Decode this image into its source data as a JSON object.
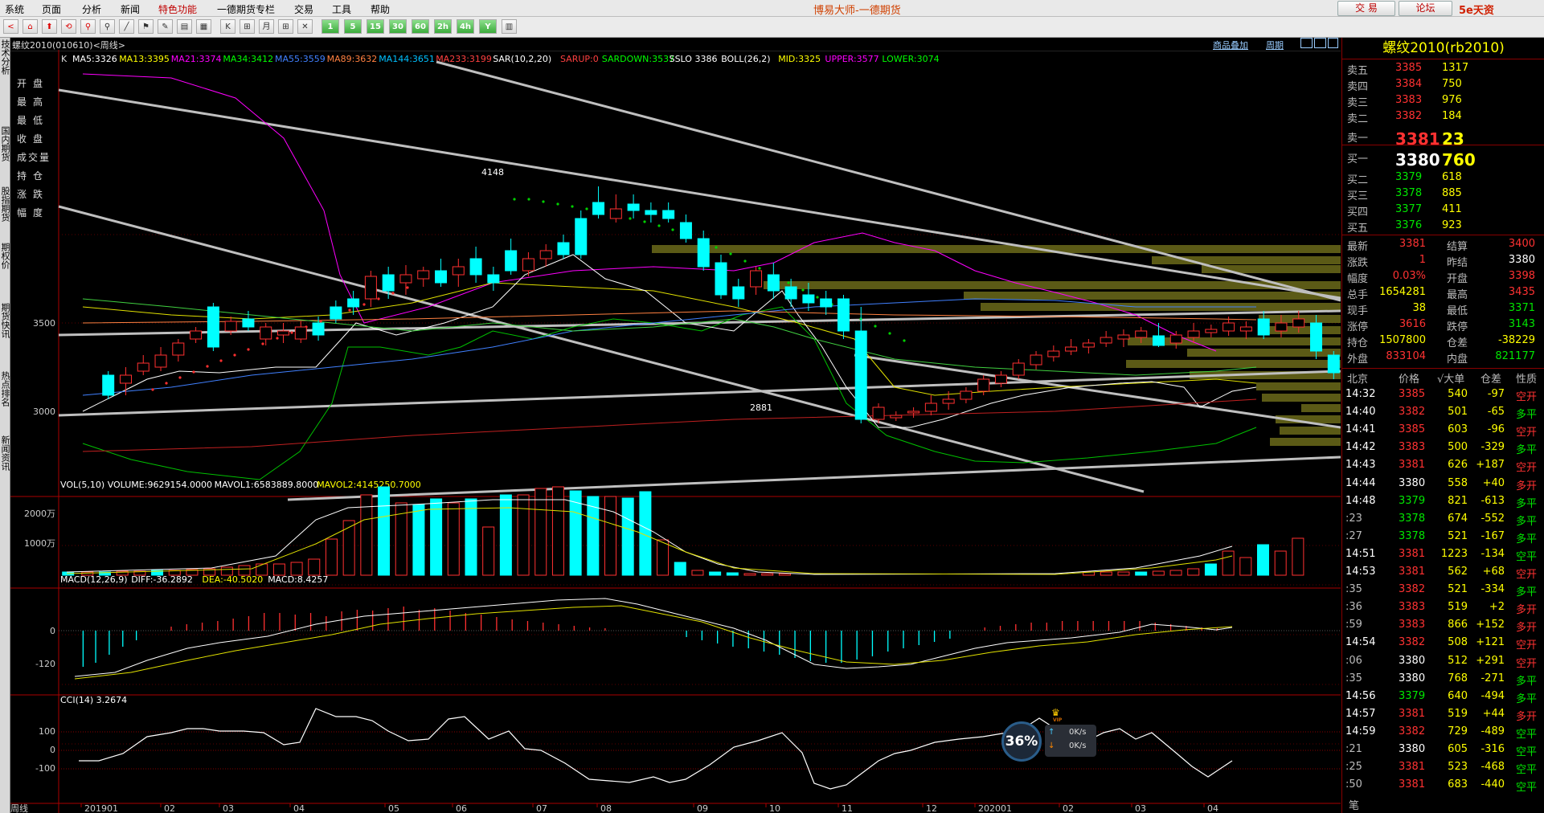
{
  "menu": [
    "系统",
    "页面",
    "分析",
    "新闻",
    "特色功能",
    "一德期货专栏",
    "交易",
    "工具",
    "帮助"
  ],
  "app_title": "博易大师-一德期货",
  "top_buttons": {
    "trade": "交 易",
    "forum": "论坛"
  },
  "logo": "5e天资 setz.com",
  "toolbar_items": [
    "<",
    "⌂",
    "⬆",
    "⟲",
    "⚲",
    "⚲",
    "╱",
    "⚑",
    "✎",
    "▤",
    "▦",
    "K",
    "⊞",
    "月",
    "⊞",
    "✕",
    "1",
    "5",
    "15",
    "30",
    "60",
    "2h",
    "4h",
    "Y",
    "▥"
  ],
  "left_tabs": [
    "技术分析",
    "国内期货",
    "股指期货",
    "期权价",
    "期货快讯",
    "热点排名",
    "新闻资讯"
  ],
  "left_labels": [
    "开盘",
    "最高",
    "最低",
    "收盘",
    "成交量",
    "持仓",
    "涨跌",
    "幅度"
  ],
  "chart_header": {
    "symbol": "螺纹2010(010610)<周线>",
    "add_product": "商品叠加",
    "period": "周期",
    "k": "K",
    "ma": [
      {
        "text": "MA5:3326",
        "color": "#ffffff"
      },
      {
        "text": "MA13:3395",
        "color": "#ffff00"
      },
      {
        "text": "MA21:3374",
        "color": "#ff00ff"
      },
      {
        "text": "MA34:3412",
        "color": "#00ff00"
      },
      {
        "text": "MA55:3559",
        "color": "#4080ff"
      },
      {
        "text": "MA89:3632",
        "color": "#ff8040"
      },
      {
        "text": "MA144:3651",
        "color": "#00c0ff"
      },
      {
        "text": "MA233:3199",
        "color": "#ff4040"
      },
      {
        "text": "SAR(10,2,20)",
        "color": "#ffffff"
      },
      {
        "text": "SARUP:0",
        "color": "#ff4040"
      },
      {
        "text": "SARDOWN:3537",
        "color": "#00ff00"
      },
      {
        "text": "SSLO 3386",
        "color": "#ffffff"
      },
      {
        "text": "BOLL(26,2)",
        "color": "#ffffff"
      },
      {
        "text": "MID:3325",
        "color": "#ffff00"
      },
      {
        "text": "UPPER:3577",
        "color": "#ff00ff"
      },
      {
        "text": "LOWER:3074",
        "color": "#00ff00"
      }
    ]
  },
  "price_axis": [
    "3500",
    "3000"
  ],
  "price_annotations": {
    "high": "4148",
    "low": "2881"
  },
  "volume_header": [
    {
      "text": "VOL(5,10) VOLUME:9629154.0000",
      "color": "#ffffff"
    },
    {
      "text": "MAVOL1:6583889.8000",
      "color": "#ffffff"
    },
    {
      "text": "MAVOL2:4145250.7000",
      "color": "#ffff00"
    }
  ],
  "volume_axis": [
    "2000万",
    "1000万"
  ],
  "macd_header": [
    {
      "text": "MACD(12,26,9)",
      "color": "#ffffff"
    },
    {
      "text": "DIFF:-36.2892",
      "color": "#ffffff"
    },
    {
      "text": "DEA:-40.5020",
      "color": "#ffff00"
    },
    {
      "text": "MACD:8.4257",
      "color": "#ffffff"
    }
  ],
  "macd_axis": [
    "0",
    "-120"
  ],
  "cci_header": [
    {
      "text": "CCI(14) 3.2674",
      "color": "#ffffff"
    }
  ],
  "cci_axis": [
    "100",
    "0",
    "-100"
  ],
  "time_axis": [
    "周线",
    "201901",
    "02",
    "03",
    "04",
    "05",
    "06",
    "07",
    "08",
    "09",
    "10",
    "11",
    "12",
    "202001",
    "02",
    "03",
    "04"
  ],
  "speed": {
    "percent": "36%",
    "up": "0K/s",
    "down": "0K/s",
    "badge": "VIP"
  },
  "quote": {
    "title": "螺纹2010(rb2010)",
    "asks": [
      {
        "label": "卖五",
        "price": "3385",
        "vol": "1317"
      },
      {
        "label": "卖四",
        "price": "3384",
        "vol": "750"
      },
      {
        "label": "卖三",
        "price": "3383",
        "vol": "976"
      },
      {
        "label": "卖二",
        "price": "3382",
        "vol": "184"
      },
      {
        "label": "卖一",
        "price": "3381",
        "vol": "23"
      }
    ],
    "bids": [
      {
        "label": "买一",
        "price": "3380",
        "vol": "760"
      },
      {
        "label": "买二",
        "price": "3379",
        "vol": "618"
      },
      {
        "label": "买三",
        "price": "3378",
        "vol": "885"
      },
      {
        "label": "买四",
        "price": "3377",
        "vol": "411"
      },
      {
        "label": "买五",
        "price": "3376",
        "vol": "923"
      }
    ],
    "stats": [
      {
        "l1": "最新",
        "v1": "3381",
        "c1": "red",
        "l2": "结算",
        "v2": "3400",
        "c2": "red"
      },
      {
        "l1": "涨跌",
        "v1": "1",
        "c1": "red",
        "l2": "昨结",
        "v2": "3380",
        "c2": "white"
      },
      {
        "l1": "幅度",
        "v1": "0.03%",
        "c1": "red",
        "l2": "开盘",
        "v2": "3398",
        "c2": "red"
      },
      {
        "l1": "总手",
        "v1": "1654281",
        "c1": "yellow",
        "l2": "最高",
        "v2": "3435",
        "c2": "red"
      },
      {
        "l1": "现手",
        "v1": "38",
        "c1": "yellow",
        "l2": "最低",
        "v2": "3371",
        "c2": "green"
      },
      {
        "l1": "涨停",
        "v1": "3616",
        "c1": "red",
        "l2": "跌停",
        "v2": "3143",
        "c2": "green"
      },
      {
        "l1": "持仓",
        "v1": "1507800",
        "c1": "yellow",
        "l2": "仓差",
        "v2": "-38229",
        "c2": "yellow"
      },
      {
        "l1": "外盘",
        "v1": "833104",
        "c1": "red",
        "l2": "内盘",
        "v2": "821177",
        "c2": "green"
      }
    ],
    "ticks_header": {
      "time": "北京",
      "price": "价格",
      "vol": "√大单",
      "diff": "仓差",
      "nature": "性质"
    },
    "ticks": [
      {
        "t": "14:32",
        "p": "3385",
        "pc": "red",
        "v": "540",
        "d": "-97",
        "n": "空开",
        "nc": "red"
      },
      {
        "t": "14:40",
        "p": "3382",
        "pc": "red",
        "v": "501",
        "d": "-65",
        "n": "多平",
        "nc": "green"
      },
      {
        "t": "14:41",
        "p": "3385",
        "pc": "red",
        "v": "603",
        "d": "-96",
        "n": "空开",
        "nc": "red"
      },
      {
        "t": "14:42",
        "p": "3383",
        "pc": "red",
        "v": "500",
        "d": "-329",
        "n": "多平",
        "nc": "green"
      },
      {
        "t": "14:43",
        "p": "3381",
        "pc": "red",
        "v": "626",
        "d": "+187",
        "n": "空开",
        "nc": "red"
      },
      {
        "t": "14:44",
        "p": "3380",
        "pc": "white",
        "v": "558",
        "d": "+40",
        "n": "多开",
        "nc": "red"
      },
      {
        "t": "14:48",
        "p": "3379",
        "pc": "green",
        "v": "821",
        "d": "-613",
        "n": "多平",
        "nc": "green"
      },
      {
        "t": ":23",
        "p": "3378",
        "pc": "green",
        "v": "674",
        "d": "-552",
        "n": "多平",
        "nc": "green"
      },
      {
        "t": ":27",
        "p": "3378",
        "pc": "green",
        "v": "521",
        "d": "-167",
        "n": "多平",
        "nc": "green"
      },
      {
        "t": "14:51",
        "p": "3381",
        "pc": "red",
        "v": "1223",
        "d": "-134",
        "n": "空平",
        "nc": "green"
      },
      {
        "t": "14:53",
        "p": "3381",
        "pc": "red",
        "v": "562",
        "d": "+68",
        "n": "空开",
        "nc": "red"
      },
      {
        "t": ":35",
        "p": "3382",
        "pc": "red",
        "v": "521",
        "d": "-334",
        "n": "多平",
        "nc": "green"
      },
      {
        "t": ":36",
        "p": "3383",
        "pc": "red",
        "v": "519",
        "d": "+2",
        "n": "多开",
        "nc": "red"
      },
      {
        "t": ":59",
        "p": "3383",
        "pc": "red",
        "v": "866",
        "d": "+152",
        "n": "多开",
        "nc": "red"
      },
      {
        "t": "14:54",
        "p": "3382",
        "pc": "red",
        "v": "508",
        "d": "+121",
        "n": "空开",
        "nc": "red"
      },
      {
        "t": ":06",
        "p": "3380",
        "pc": "white",
        "v": "512",
        "d": "+291",
        "n": "空开",
        "nc": "red"
      },
      {
        "t": ":35",
        "p": "3380",
        "pc": "white",
        "v": "768",
        "d": "-271",
        "n": "多平",
        "nc": "green"
      },
      {
        "t": "14:56",
        "p": "3379",
        "pc": "green",
        "v": "640",
        "d": "-494",
        "n": "多平",
        "nc": "green"
      },
      {
        "t": "14:57",
        "p": "3381",
        "pc": "red",
        "v": "519",
        "d": "+44",
        "n": "多开",
        "nc": "red"
      },
      {
        "t": "14:59",
        "p": "3382",
        "pc": "red",
        "v": "729",
        "d": "-489",
        "n": "空平",
        "nc": "green"
      },
      {
        "t": ":21",
        "p": "3380",
        "pc": "white",
        "v": "605",
        "d": "-316",
        "n": "空平",
        "nc": "green"
      },
      {
        "t": ":25",
        "p": "3381",
        "pc": "red",
        "v": "523",
        "d": "-468",
        "n": "空平",
        "nc": "green"
      },
      {
        "t": ":50",
        "p": "3381",
        "pc": "red",
        "v": "683",
        "d": "-440",
        "n": "空平",
        "nc": "green"
      }
    ],
    "footer": "笔"
  }
}
